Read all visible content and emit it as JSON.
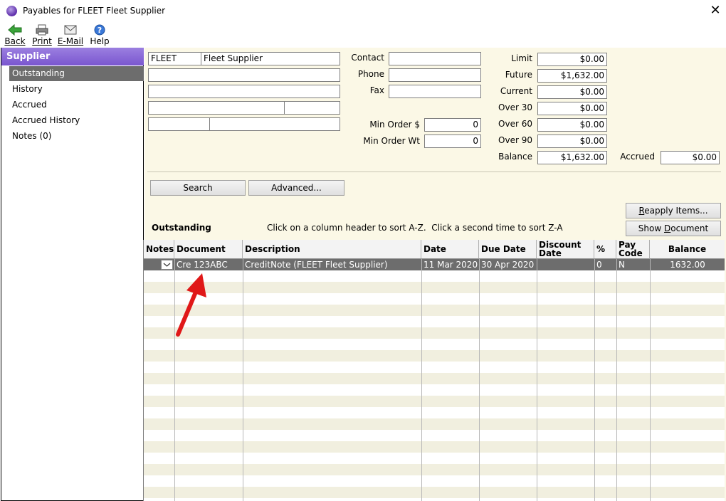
{
  "window": {
    "title": "Payables for FLEET Fleet Supplier"
  },
  "toolbar": {
    "back": "Back",
    "print": "Print",
    "email": "E-Mail",
    "help": "Help"
  },
  "nav": {
    "header": "Supplier",
    "items": [
      {
        "label": "Outstanding"
      },
      {
        "label": "History"
      },
      {
        "label": "Accrued"
      },
      {
        "label": "Accrued History"
      },
      {
        "label": "Notes (0)"
      }
    ]
  },
  "supplier": {
    "code": "FLEET",
    "name": "Fleet Supplier",
    "address1": "",
    "address2": "",
    "address3a": "",
    "address3b": "",
    "address4a": "",
    "address4b": ""
  },
  "contact": {
    "contact_label": "Contact",
    "contact_value": "",
    "phone_label": "Phone",
    "phone_value": "",
    "fax_label": "Fax",
    "fax_value": "",
    "min_order_label": "Min Order $",
    "min_order_value": "0",
    "min_order_wt_label": "Min Order Wt",
    "min_order_wt_value": "0"
  },
  "aging": {
    "limit_label": "Limit",
    "limit": "$0.00",
    "future_label": "Future",
    "future": "$1,632.00",
    "current_label": "Current",
    "current": "$0.00",
    "over30_label": "Over 30",
    "over30": "$0.00",
    "over60_label": "Over 60",
    "over60": "$0.00",
    "over90_label": "Over 90",
    "over90": "$0.00",
    "balance_label": "Balance",
    "balance": "$1,632.00",
    "accrued_label": "Accrued",
    "accrued": "$0.00"
  },
  "actions": {
    "search": "Search",
    "advanced": "Advanced...",
    "reapply_prefix": "",
    "reapply_u": "R",
    "reapply_rest": "eapply Items...",
    "show_doc_prefix": "Show ",
    "show_doc_u": "D",
    "show_doc_rest": "ocument"
  },
  "list": {
    "section_label": "Outstanding",
    "hint": "Click on a column header to sort A-Z.  Click a second time to sort Z-A",
    "columns": [
      "Notes",
      "Document",
      "Description",
      "Date",
      "Due Date",
      "Discount Date",
      "%",
      "Pay Code",
      "Balance"
    ],
    "rows": [
      {
        "notes": "",
        "document": "Cre 123ABC",
        "description": "CreditNote (FLEET Fleet Supplier)",
        "date": "11 Mar 2020",
        "due_date": "30 Apr 2020",
        "discount_date": "",
        "pct": "0",
        "pay_code": "N",
        "balance": "1632.00"
      }
    ]
  },
  "colors": {
    "nav_header": "#8a6ad8",
    "selected_row": "#6d6d6d",
    "pane_bg": "#fbf8e6",
    "arrow": "#e01818"
  }
}
